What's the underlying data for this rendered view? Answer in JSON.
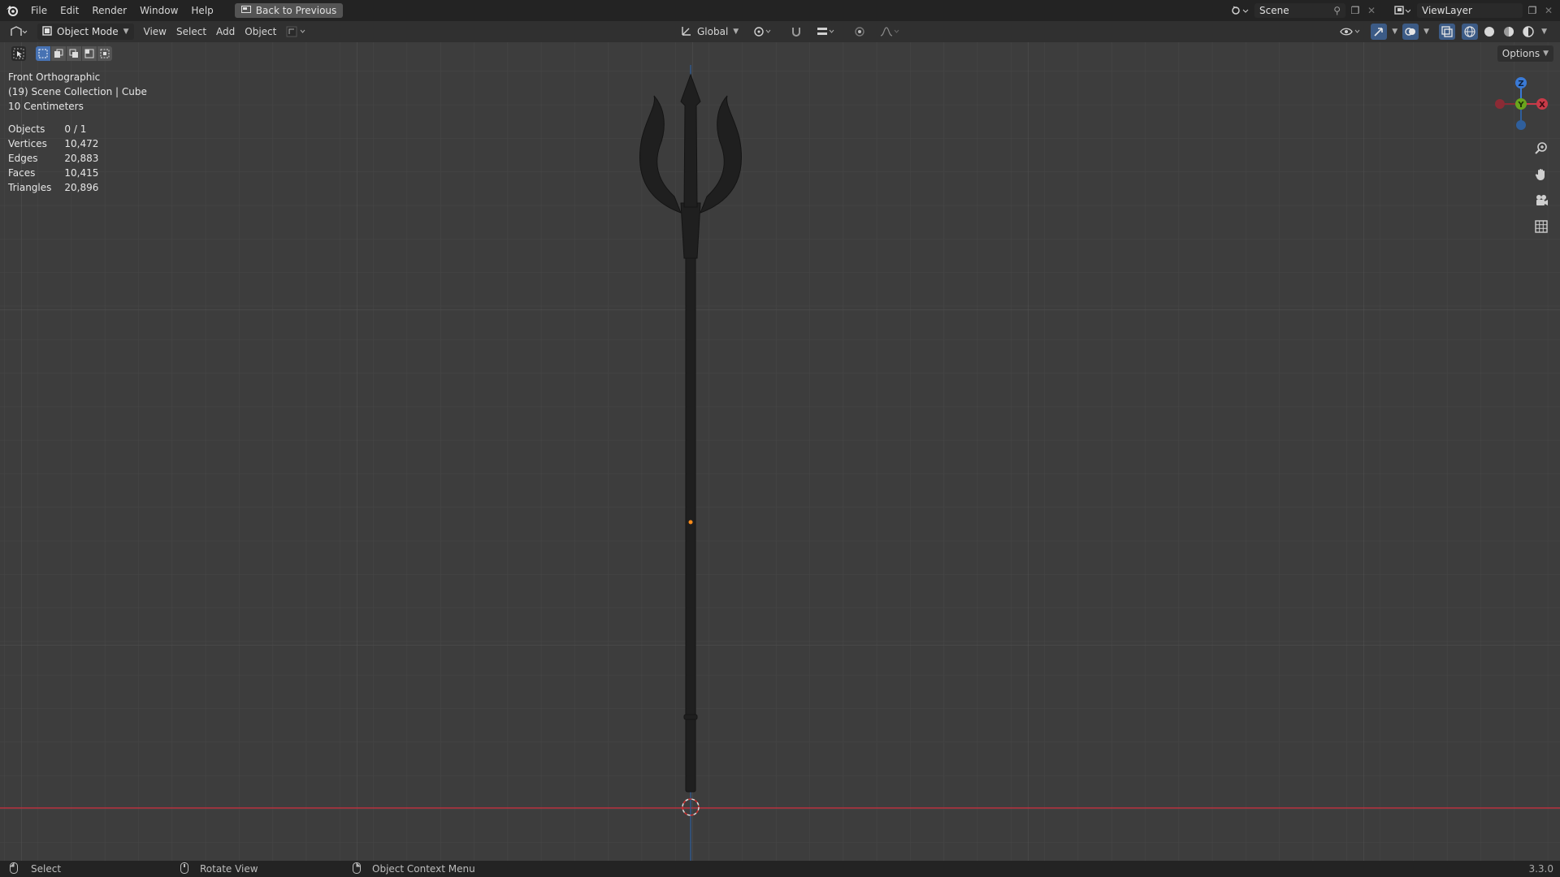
{
  "menubar": {
    "items": [
      "File",
      "Edit",
      "Render",
      "Window",
      "Help"
    ],
    "back_button": "Back to Previous"
  },
  "topright": {
    "scene": "Scene",
    "view_layer": "ViewLayer"
  },
  "header": {
    "mode": "Object Mode",
    "menus": [
      "View",
      "Select",
      "Add",
      "Object"
    ],
    "transform_orientation": "Global"
  },
  "options_label": "Options",
  "viewport": {
    "view_name": "Front Orthographic",
    "collection_info": "(19) Scene Collection | Cube",
    "scale": "10 Centimeters",
    "stats": [
      {
        "label": "Objects",
        "value": "0 / 1"
      },
      {
        "label": "Vertices",
        "value": "10,472"
      },
      {
        "label": "Edges",
        "value": "20,883"
      },
      {
        "label": "Faces",
        "value": "10,415"
      },
      {
        "label": "Triangles",
        "value": "20,896"
      }
    ]
  },
  "gizmo": {
    "x": "X",
    "y": "Y",
    "z": "Z"
  },
  "statusbar": {
    "select": "Select",
    "rotate": "Rotate View",
    "context": "Object Context Menu",
    "version": "3.3.0"
  },
  "colors": {
    "x_axis": "#c83a48",
    "y_axis": "#6aa51d",
    "z_axis": "#3a7ad6",
    "background": "#3d3d3d",
    "grid": "#474747"
  }
}
